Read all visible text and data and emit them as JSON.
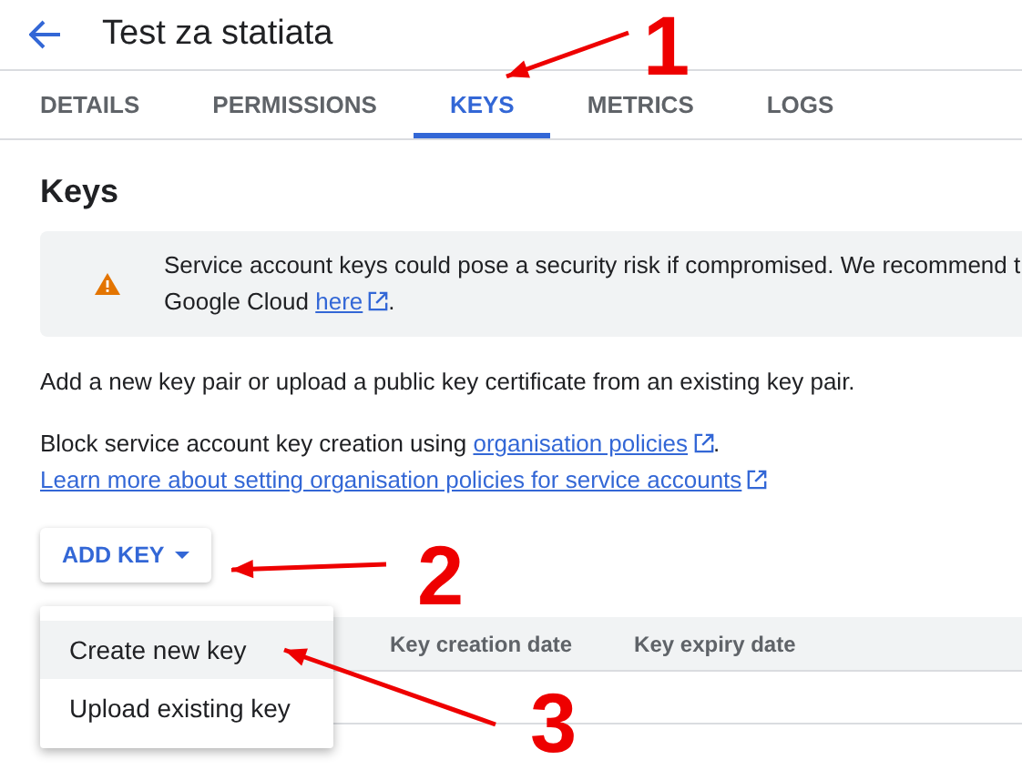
{
  "header": {
    "title": "Test za statiata"
  },
  "tabs": [
    {
      "label": "DETAILS",
      "selected": false
    },
    {
      "label": "PERMISSIONS",
      "selected": false
    },
    {
      "label": "KEYS",
      "selected": true
    },
    {
      "label": "METRICS",
      "selected": false
    },
    {
      "label": "LOGS",
      "selected": false
    }
  ],
  "section_title": "Keys",
  "warning": {
    "text": "Service account keys could pose a security risk if compromised. We recommend t",
    "text_2": "Google Cloud ",
    "link": "here",
    "after": "."
  },
  "intro": "Add a new key pair or upload a public key certificate from an existing key pair.",
  "policy": {
    "text": "Block service account key creation using ",
    "link": "organisation policies",
    "after": "."
  },
  "learn_more": "Learn more about setting organisation policies for service accounts",
  "add_key_button": "ADD KEY",
  "menu": [
    {
      "label": "Create new key",
      "selected": true
    },
    {
      "label": "Upload existing key",
      "selected": false
    }
  ],
  "table": {
    "columns": [
      "Key creation date",
      "Key expiry date"
    ]
  },
  "annotations": [
    {
      "label": "1"
    },
    {
      "label": "2"
    },
    {
      "label": "3"
    }
  ]
}
